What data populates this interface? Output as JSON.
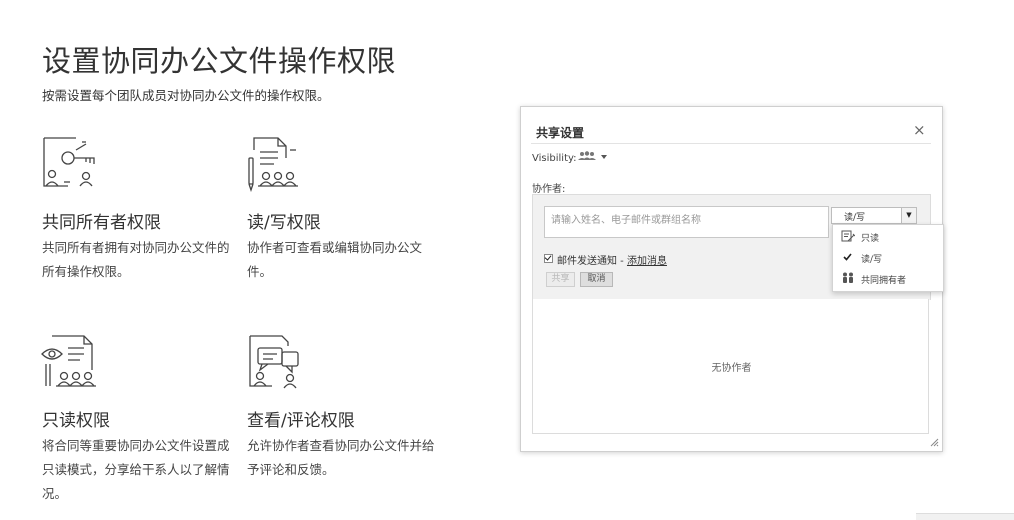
{
  "page": {
    "title": "设置协同办公文件操作权限",
    "subtitle": "按需设置每个团队成员对协同办公文件的操作权限。"
  },
  "features": [
    {
      "icon": "key-document-icon",
      "title": "共同所有者权限",
      "desc": "共同所有者拥有对协同办公文件的所有操作权限。"
    },
    {
      "icon": "pencil-document-icon",
      "title": "读/写权限",
      "desc": "协作者可查看或编辑协同办公文件。"
    },
    {
      "icon": "eye-document-icon",
      "title": "只读权限",
      "desc": "将合同等重要协同办公文件设置成只读模式，分享给干系人以了解情况。"
    },
    {
      "icon": "comment-document-icon",
      "title": "查看/评论权限",
      "desc": "允许协作者查看协同办公文件并给予评论和反馈。"
    }
  ],
  "dialog": {
    "title": "共享设置",
    "close": "×",
    "visibility_label": "Visibility:",
    "collaborators_label": "协作者:",
    "input_placeholder": "请输入姓名、电子邮件或群组名称",
    "permission_selected": "读/写",
    "notify_text": "邮件发送通知 - ",
    "add_message": "添加消息",
    "notify_checked": true,
    "share_button": "共享",
    "cancel_button": "取消",
    "empty_text": "无协作者"
  },
  "permission_menu": {
    "items": [
      {
        "label": "只读",
        "icon": "read-only-icon"
      },
      {
        "label": "读/写",
        "icon": "check-icon",
        "selected": true
      },
      {
        "label": "共同拥有者",
        "icon": "co-owner-icon"
      }
    ]
  }
}
